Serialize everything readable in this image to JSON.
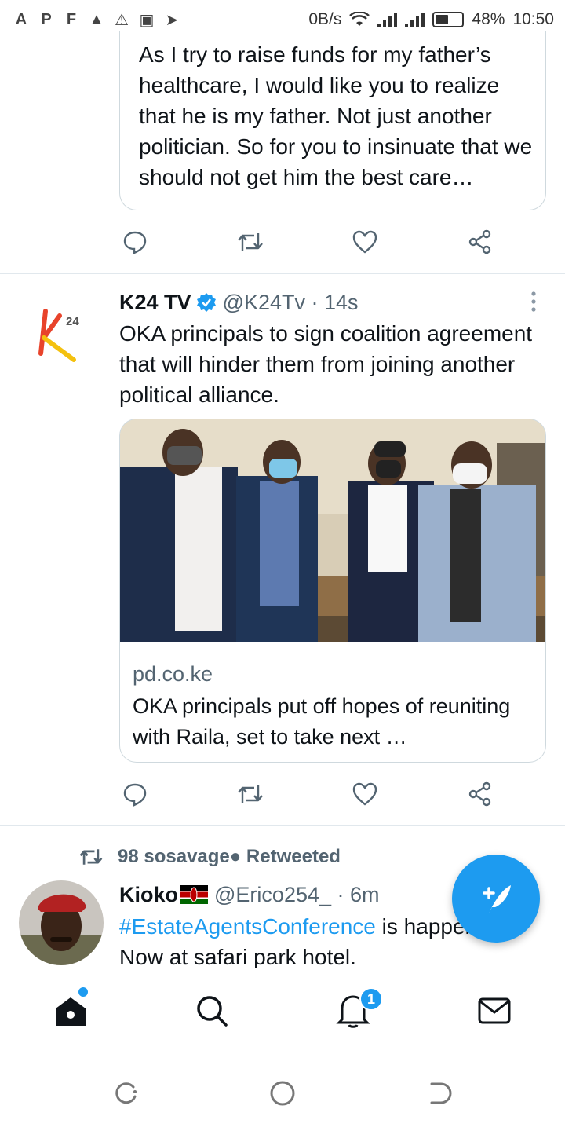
{
  "status_bar": {
    "notification_icons": [
      "A",
      "P",
      "F",
      "▲",
      "⚠",
      "▣",
      "➤"
    ],
    "net_speed": "0B/s",
    "battery": "48%",
    "battery_level": 0.48,
    "time": "10:50"
  },
  "tweet1": {
    "quote_text": "As I try to raise funds for my father’s healthcare, I would like you to realize that he is my father. Not just another politician. So for you to insinuate that we should not get him the best care…"
  },
  "tweet2": {
    "name": "K24 TV",
    "handle": "@K24Tv · 14s",
    "text": "OKA principals to sign coalition agreement that will hinder them from joining another political alliance.",
    "card": {
      "domain": "pd.co.ke",
      "headline": "OKA principals put off hopes of reuniting with Raila, set to take next …"
    }
  },
  "tweet3": {
    "retweeted_by": "98 sosavage● Retweeted",
    "name": "Kioko",
    "handle": "@Erico254_ · 6m",
    "hashtag": "#EstateAgentsConference",
    "text_after_hashtag": " is happening",
    "text_line2": "Now at safari park hotel."
  },
  "bottom_nav": {
    "notification_count": "1"
  },
  "colors": {
    "accent": "#1d9bf0",
    "text": "#0f1419",
    "secondary": "#536471",
    "border": "#cfd9de"
  },
  "icons": [
    "reply-icon",
    "retweet-icon",
    "like-icon",
    "share-icon",
    "verified-icon",
    "more-icon",
    "compose-icon",
    "home-icon",
    "search-icon",
    "notifications-icon",
    "messages-icon"
  ]
}
